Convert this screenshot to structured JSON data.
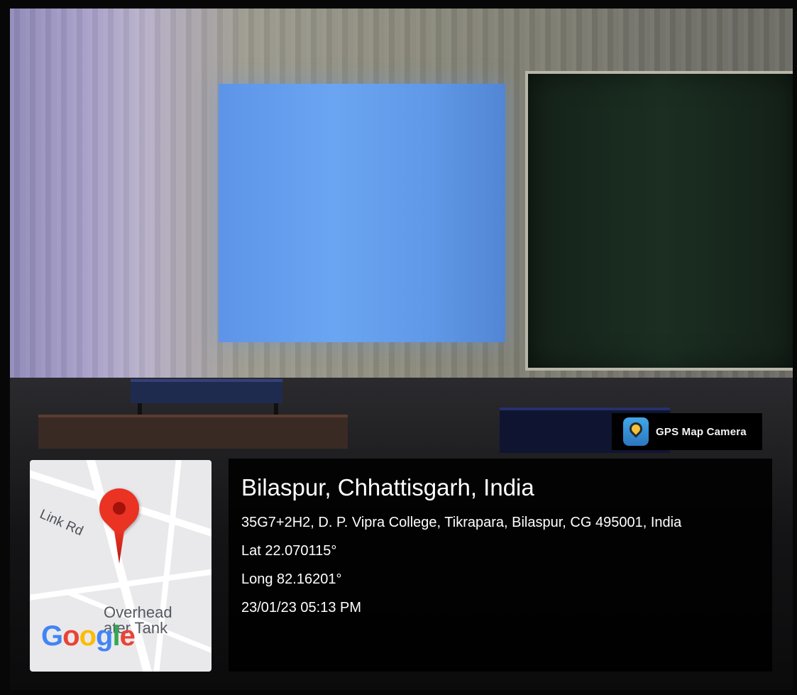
{
  "badge": {
    "app_name": "GPS Map Camera",
    "icon": "gps-map-camera-app-icon"
  },
  "map_thumbnail": {
    "road_label": "Link Rd",
    "landmark_label": "Overhead\nater Tank",
    "pin_icon": "map-pin-icon",
    "logo_text": "Google",
    "pin_color": "#ea3323"
  },
  "location": {
    "place": "Bilaspur, Chhattisgarh, India",
    "address": "35G7+2H2, D. P. Vipra College, Tikrapara, Bilaspur, CG 495001, India",
    "latitude": "Lat 22.070115°",
    "longitude": "Long 82.16201°",
    "timestamp": "23/01/23 05:13 PM"
  },
  "colors": {
    "projection": "#6aa5f2",
    "chalkboard": "#17261c",
    "overlay": "#000000"
  }
}
